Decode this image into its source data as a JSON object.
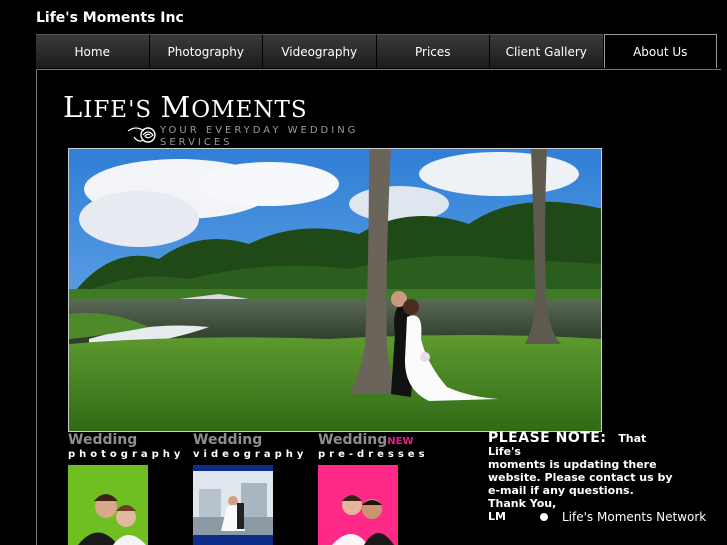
{
  "site": {
    "title": "Life's Moments Inc"
  },
  "nav": {
    "items": [
      {
        "label": "Home"
      },
      {
        "label": "Photography"
      },
      {
        "label": "Videography"
      },
      {
        "label": "Prices"
      },
      {
        "label": "Client Gallery"
      },
      {
        "label": "About Us"
      }
    ],
    "active": "About Us"
  },
  "logo": {
    "text": "Life's Moments",
    "tagline": "YOUR EVERYDAY WEDDING SERVICES"
  },
  "services": [
    {
      "title": "Wedding",
      "subtitle": "photography"
    },
    {
      "title": "Wedding",
      "subtitle": "videography"
    },
    {
      "title": "Wedding",
      "badge": "NEW",
      "subtitle": "pre-dresses"
    }
  ],
  "note": {
    "heading": "PLEASE NOTE:",
    "line1": "That",
    "line2": "Life's",
    "line3": "moments is updating there",
    "line4": "website. Please contact us by",
    "line5": "e-mail if any questions.",
    "line6": "Thank You,",
    "line7": "LM"
  },
  "network": {
    "label": "Life's Moments Network"
  },
  "colors": {
    "background": "#000000",
    "accent_new": "#e0208a",
    "muted": "#8e8e8e"
  }
}
